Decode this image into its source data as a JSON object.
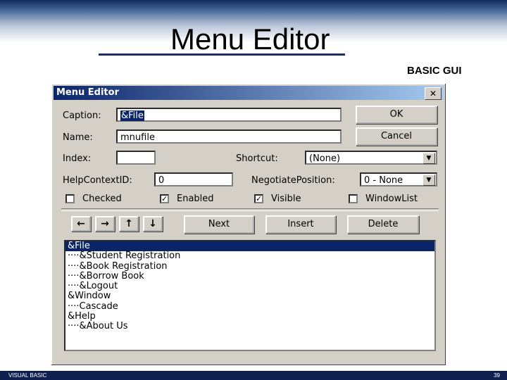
{
  "slide": {
    "title": "Menu Editor",
    "subtitle": "BASIC GUI",
    "footer_left": "VISUAL BASIC",
    "footer_right": "39"
  },
  "dialog": {
    "title": "Menu Editor",
    "close_label": "✕",
    "caption_label": "Caption:",
    "caption_value": "&File",
    "name_label": "Name:",
    "name_value": "mnufile",
    "index_label": "Index:",
    "index_value": "",
    "shortcut_label": "Shortcut:",
    "shortcut_value": "(None)",
    "helpcontext_label": "HelpContextID:",
    "helpcontext_value": "0",
    "negotiate_label": "NegotiatePosition:",
    "negotiate_value": "0 - None",
    "ok_label": "OK",
    "cancel_label": "Cancel",
    "checkboxes": [
      {
        "label": "Checked",
        "checked": false
      },
      {
        "label": "Enabled",
        "checked": true
      },
      {
        "label": "Visible",
        "checked": true
      },
      {
        "label": "WindowList",
        "checked": false
      }
    ],
    "arrows": [
      "←",
      "→",
      "↑",
      "↓"
    ],
    "next_label": "Next",
    "insert_label": "Insert",
    "delete_label": "Delete",
    "menu_items": [
      "&File",
      "····&Student Registration",
      "····&Book Registration",
      "····&Borrow Book",
      "····&Logout",
      "&Window",
      "····Cascade",
      "&Help",
      "····&About Us"
    ],
    "selected_index": 0
  }
}
